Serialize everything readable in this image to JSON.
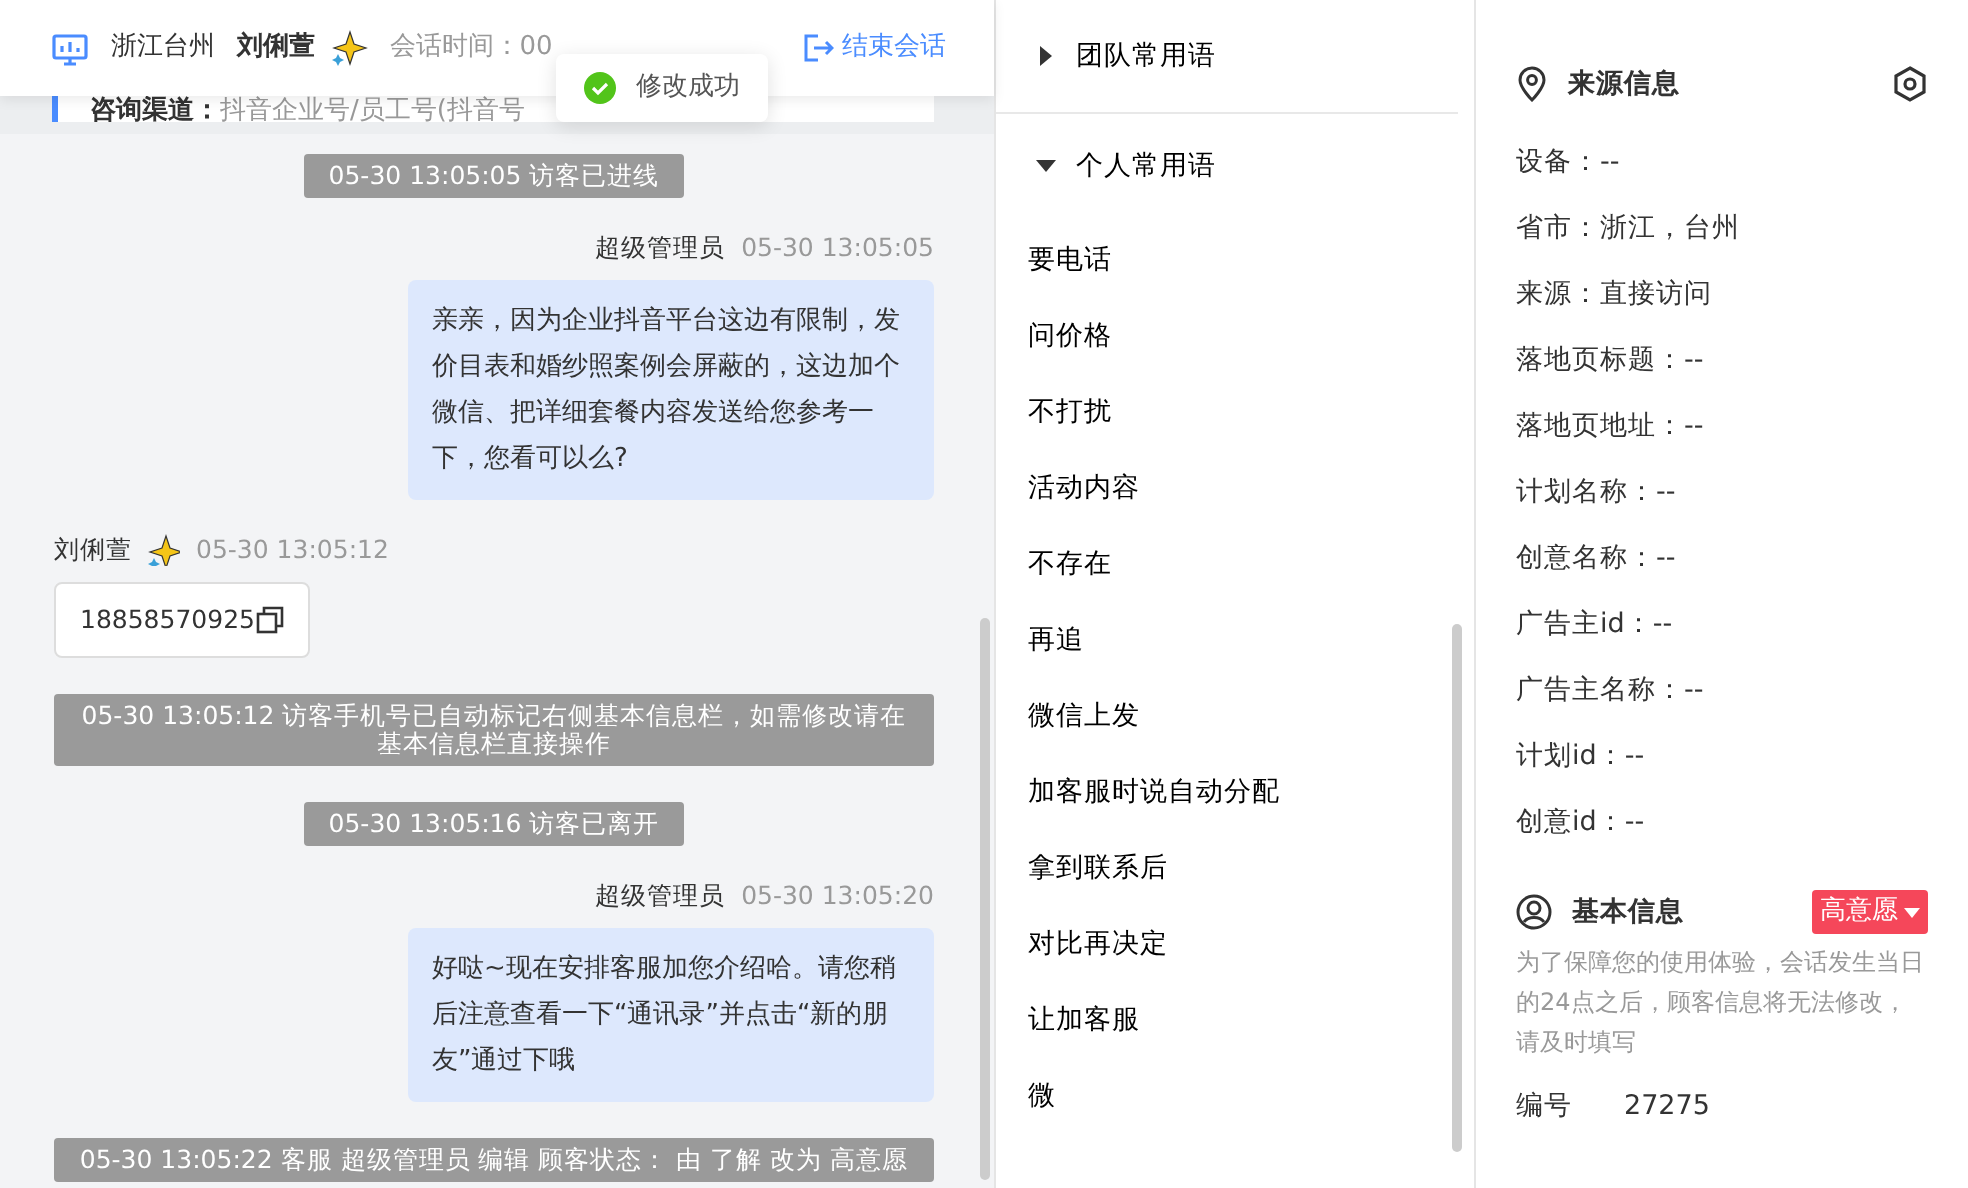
{
  "header": {
    "location": "浙江台州",
    "visitor_name": "刘俐萱",
    "session_time": "会话时间：00",
    "end_button": "结束会话"
  },
  "toast": {
    "text": "修改成功"
  },
  "channel": {
    "label": "咨询渠道：",
    "value": "抖音企业号/员工号(抖音号"
  },
  "messages": [
    {
      "kind": "system",
      "text": "05-30 13:05:05 访客已进线"
    },
    {
      "kind": "agent",
      "sender": "超级管理员",
      "time": "05-30 13:05:05",
      "text": "亲亲，因为企业抖音平台这边有限制，发价目表和婚纱照案例会屏蔽的，这边加个微信、把详细套餐内容发送给您参考一下，您看可以么?"
    },
    {
      "kind": "visitor",
      "sender": "刘俐萱",
      "time": "05-30 13:05:12",
      "text": "18858570925"
    },
    {
      "kind": "system",
      "text": "05-30 13:05:12 访客手机号已自动标记右侧基本信息栏，如需修改请在基本信息栏直接操作"
    },
    {
      "kind": "system",
      "text": "05-30 13:05:16 访客已离开"
    },
    {
      "kind": "agent",
      "sender": "超级管理员",
      "time": "05-30 13:05:20",
      "text": "好哒~现在安排客服加您介绍哈。请您稍后注意查看一下“通讯录”并点击“新的朋友”通过下哦"
    },
    {
      "kind": "system",
      "text": "05-30 13:05:22 客服 超级管理员 编辑 顾客状态： 由 了解 改为 高意愿"
    }
  ],
  "phrase_groups": [
    {
      "title": "团队常用语",
      "expanded": false
    },
    {
      "title": "个人常用语",
      "expanded": true,
      "items": [
        "要电话",
        "问价格",
        "不打扰",
        "活动内容",
        "不存在",
        "再追",
        "微信上发",
        "加客服时说自动分配",
        "拿到联系后",
        "对比再决定",
        "让加客服",
        "微"
      ]
    }
  ],
  "source_info": {
    "title": "来源信息",
    "fields": [
      "设备：--",
      "省市：浙江，台州",
      "来源：直接访问",
      "落地页标题：--",
      "落地页地址：--",
      "计划名称：--",
      "创意名称：--",
      "广告主id：--",
      "广告主名称：--",
      "计划id：--",
      "创意id：--"
    ]
  },
  "basic_info": {
    "title": "基本信息",
    "status": "高意愿",
    "note": "为了保障您的使用体验，会话发生当日的24点之后，顾客信息将无法修改，请及时填写",
    "fields": [
      {
        "label": "编号",
        "value": "27275"
      }
    ]
  }
}
